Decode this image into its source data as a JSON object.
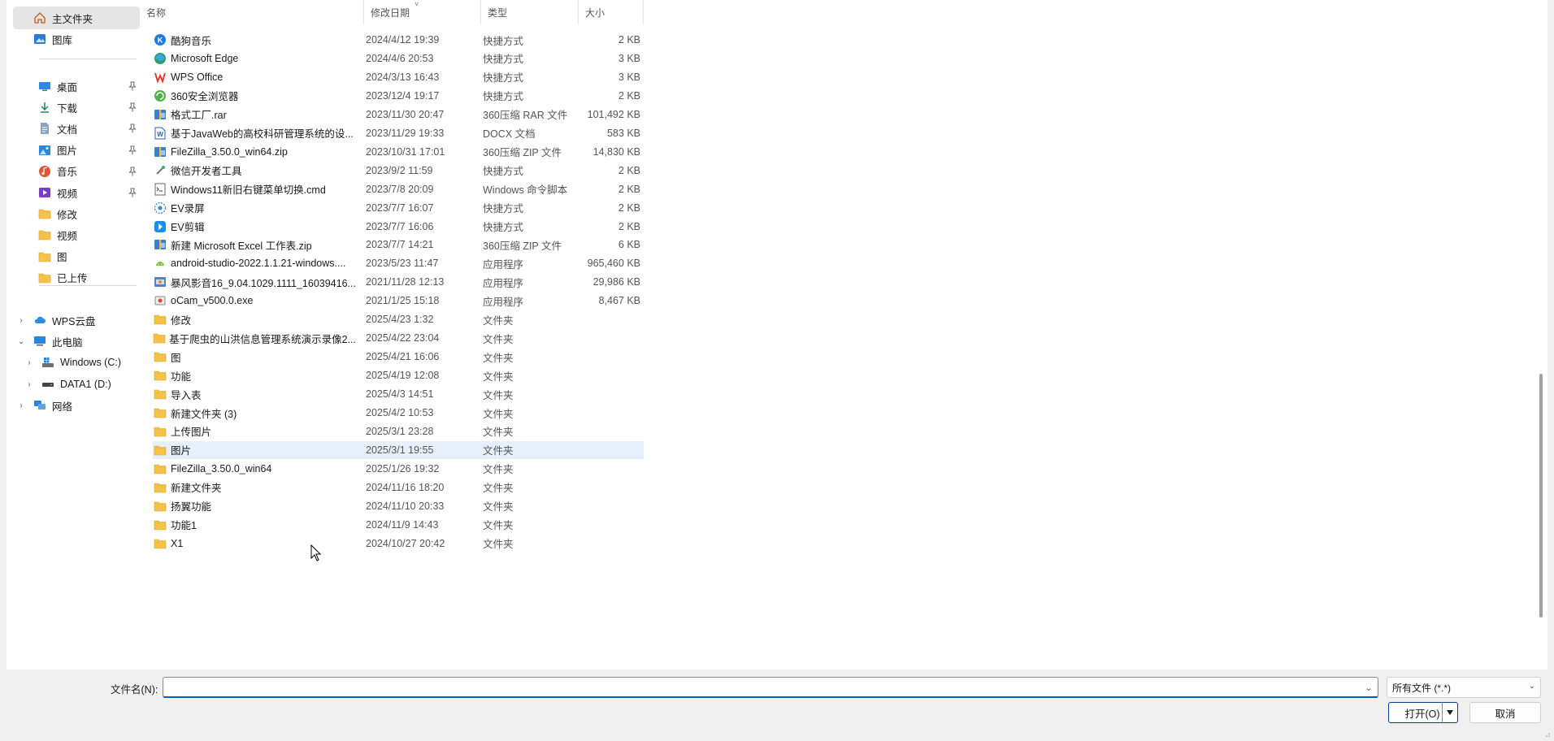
{
  "sidebar": {
    "top": [
      {
        "label": "主文件夹",
        "icon": "home-icon",
        "selected": true
      },
      {
        "label": "图库",
        "icon": "gallery-icon"
      }
    ],
    "quick": [
      {
        "label": "桌面",
        "icon": "desktop-icon",
        "pinned": true
      },
      {
        "label": "下载",
        "icon": "download-icon",
        "pinned": true
      },
      {
        "label": "文档",
        "icon": "document-icon",
        "pinned": true
      },
      {
        "label": "图片",
        "icon": "pictures-icon",
        "pinned": true
      },
      {
        "label": "音乐",
        "icon": "music-icon",
        "pinned": true
      },
      {
        "label": "视频",
        "icon": "videos-icon",
        "pinned": true
      },
      {
        "label": "修改",
        "icon": "folder-icon"
      },
      {
        "label": "视频",
        "icon": "folder-icon"
      },
      {
        "label": "图",
        "icon": "folder-icon"
      },
      {
        "label": "已上传",
        "icon": "folder-icon"
      }
    ],
    "tree": [
      {
        "label": "WPS云盘",
        "icon": "cloud-icon",
        "chevron": ">"
      },
      {
        "label": "此电脑",
        "icon": "this-pc-icon",
        "chevron": "v"
      },
      {
        "label": "Windows (C:)",
        "icon": "windows-drive-icon",
        "chevron": ">"
      },
      {
        "label": "DATA1 (D:)",
        "icon": "drive-icon",
        "chevron": ">"
      },
      {
        "label": "网络",
        "icon": "network-icon",
        "chevron": ">"
      }
    ]
  },
  "columns": {
    "name": "名称",
    "date": "修改日期",
    "type": "类型",
    "size": "大小"
  },
  "files": [
    {
      "name": "酷狗音乐",
      "date": "2024/4/12 19:39",
      "type": "快捷方式",
      "size": "2 KB",
      "icon": "kugou-icon"
    },
    {
      "name": "Microsoft Edge",
      "date": "2024/4/6 20:53",
      "type": "快捷方式",
      "size": "3 KB",
      "icon": "edge-icon"
    },
    {
      "name": "WPS Office",
      "date": "2024/3/13 16:43",
      "type": "快捷方式",
      "size": "3 KB",
      "icon": "wps-icon"
    },
    {
      "name": "360安全浏览器",
      "date": "2023/12/4 19:17",
      "type": "快捷方式",
      "size": "2 KB",
      "icon": "360-browser-icon"
    },
    {
      "name": "格式工厂.rar",
      "date": "2023/11/30 20:47",
      "type": "360压缩 RAR 文件",
      "size": "101,492 KB",
      "icon": "archive-icon"
    },
    {
      "name": "基于JavaWeb的高校科研管理系统的设...",
      "date": "2023/11/29 19:33",
      "type": "DOCX 文档",
      "size": "583 KB",
      "icon": "word-doc-icon"
    },
    {
      "name": "FileZilla_3.50.0_win64.zip",
      "date": "2023/10/31 17:01",
      "type": "360压缩 ZIP 文件",
      "size": "14,830 KB",
      "icon": "archive-icon"
    },
    {
      "name": "微信开发者工具",
      "date": "2023/9/2 11:59",
      "type": "快捷方式",
      "size": "2 KB",
      "icon": "wechat-devtools-icon"
    },
    {
      "name": "Windows11新旧右键菜单切换.cmd",
      "date": "2023/7/8 20:09",
      "type": "Windows 命令脚本",
      "size": "2 KB",
      "icon": "cmd-script-icon"
    },
    {
      "name": "EV录屏",
      "date": "2023/7/7 16:07",
      "type": "快捷方式",
      "size": "2 KB",
      "icon": "ev-recorder-icon"
    },
    {
      "name": "EV剪辑",
      "date": "2023/7/7 16:06",
      "type": "快捷方式",
      "size": "2 KB",
      "icon": "ev-editor-icon"
    },
    {
      "name": "新建 Microsoft Excel 工作表.zip",
      "date": "2023/7/7 14:21",
      "type": "360压缩 ZIP 文件",
      "size": "6 KB",
      "icon": "archive-icon"
    },
    {
      "name": "android-studio-2022.1.1.21-windows....",
      "date": "2023/5/23 11:47",
      "type": "应用程序",
      "size": "965,460 KB",
      "icon": "android-icon"
    },
    {
      "name": "暴风影音16_9.04.1029.1111_16039416...",
      "date": "2021/11/28 12:13",
      "type": "应用程序",
      "size": "29,986 KB",
      "icon": "app-installer-icon"
    },
    {
      "name": "oCam_v500.0.exe",
      "date": "2021/1/25 15:18",
      "type": "应用程序",
      "size": "8,467 KB",
      "icon": "exe-icon"
    },
    {
      "name": "修改",
      "date": "2025/4/23 1:32",
      "type": "文件夹",
      "size": "",
      "icon": "folder-icon"
    },
    {
      "name": "基于爬虫的山洪信息管理系统演示录像2...",
      "date": "2025/4/22 23:04",
      "type": "文件夹",
      "size": "",
      "icon": "folder-icon"
    },
    {
      "name": "图",
      "date": "2025/4/21 16:06",
      "type": "文件夹",
      "size": "",
      "icon": "folder-icon"
    },
    {
      "name": "功能",
      "date": "2025/4/19 12:08",
      "type": "文件夹",
      "size": "",
      "icon": "folder-icon"
    },
    {
      "name": "导入表",
      "date": "2025/4/3 14:51",
      "type": "文件夹",
      "size": "",
      "icon": "folder-icon"
    },
    {
      "name": "新建文件夹 (3)",
      "date": "2025/4/2 10:53",
      "type": "文件夹",
      "size": "",
      "icon": "folder-icon"
    },
    {
      "name": "上传图片",
      "date": "2025/3/1 23:28",
      "type": "文件夹",
      "size": "",
      "icon": "folder-icon"
    },
    {
      "name": "图片",
      "date": "2025/3/1 19:55",
      "type": "文件夹",
      "size": "",
      "icon": "folder-icon",
      "hover": true
    },
    {
      "name": "FileZilla_3.50.0_win64",
      "date": "2025/1/26 19:32",
      "type": "文件夹",
      "size": "",
      "icon": "folder-icon"
    },
    {
      "name": "新建文件夹",
      "date": "2024/11/16 18:20",
      "type": "文件夹",
      "size": "",
      "icon": "folder-icon"
    },
    {
      "name": "扬翼功能",
      "date": "2024/11/10 20:33",
      "type": "文件夹",
      "size": "",
      "icon": "folder-icon"
    },
    {
      "name": "功能1",
      "date": "2024/11/9 14:43",
      "type": "文件夹",
      "size": "",
      "icon": "folder-icon"
    },
    {
      "name": "X1",
      "date": "2024/10/27 20:42",
      "type": "文件夹",
      "size": "",
      "icon": "folder-icon"
    }
  ],
  "bottom": {
    "filename_label": "文件名(N):",
    "filename_value": "",
    "filter_label": "所有文件 (*.*)",
    "open_label": "打开(O)",
    "cancel_label": "取消"
  },
  "colors": {
    "accent": "#005fb8",
    "folder": "#f5c24c",
    "hover_row": "#e5f0fb",
    "selected_nav": "#e5e5e5"
  }
}
